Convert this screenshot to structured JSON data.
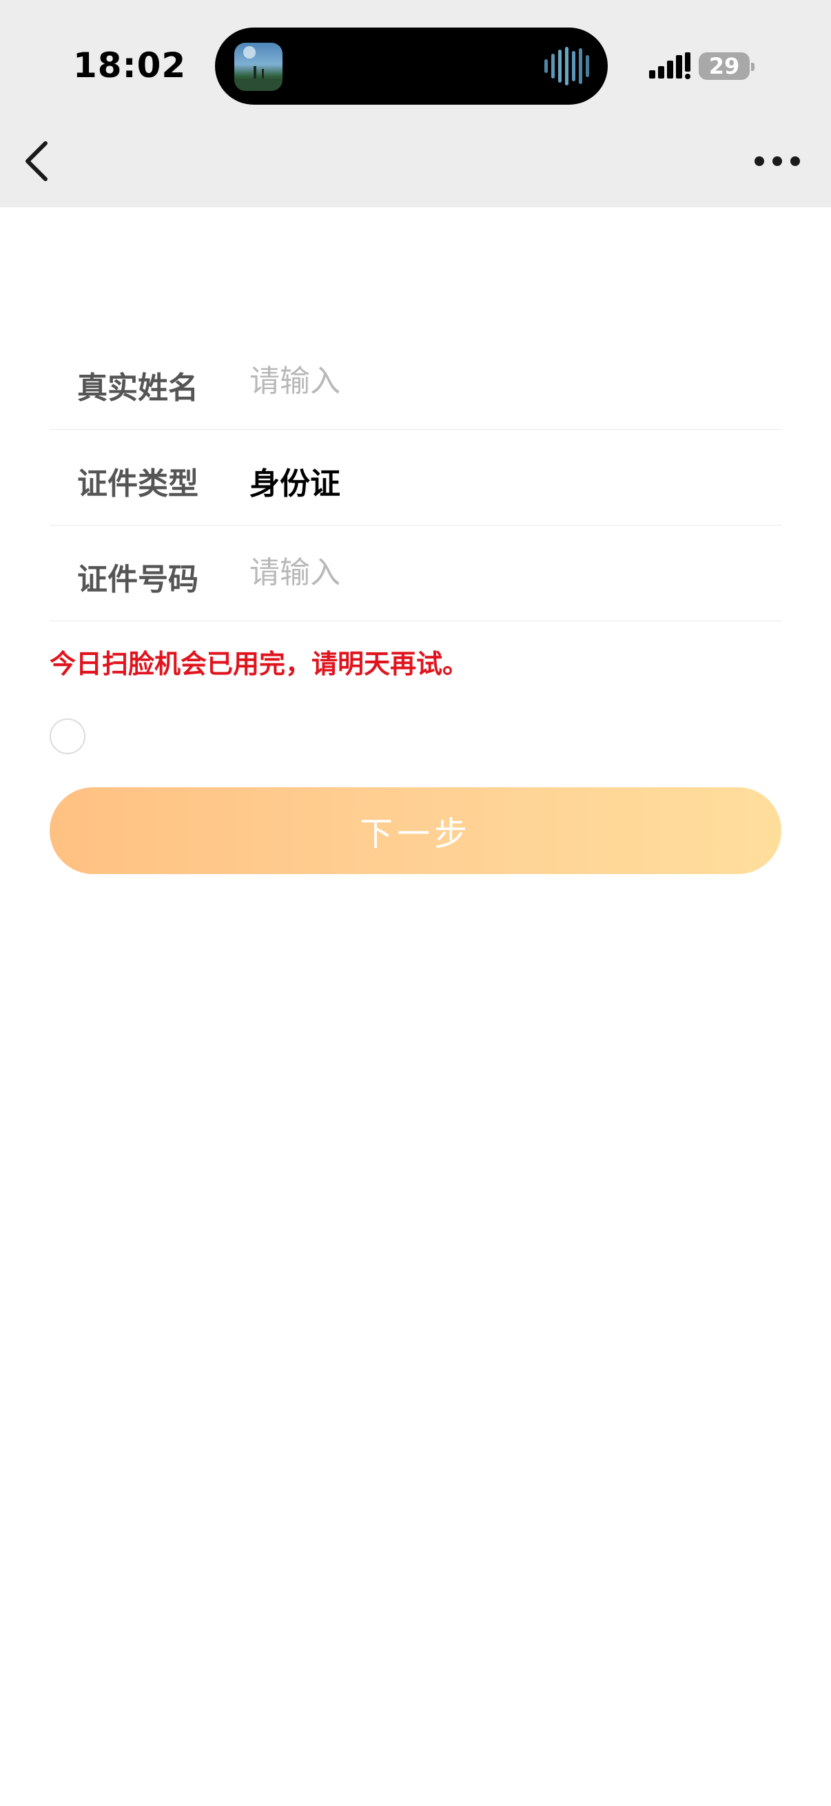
{
  "status_bar": {
    "time": "18:02",
    "battery_level": "29",
    "signal_icon": "cellular-signal-icon",
    "battery_icon": "battery-icon"
  },
  "nav": {
    "back_icon": "chevron-left-icon",
    "more_icon": "more-dots-icon"
  },
  "form": {
    "real_name": {
      "label": "真实姓名",
      "placeholder": "请输入",
      "value": ""
    },
    "id_type": {
      "label": "证件类型",
      "value": "身份证"
    },
    "id_number": {
      "label": "证件号码",
      "placeholder": "请输入",
      "value": ""
    }
  },
  "error_message": "今日扫脸机会已用完，请明天再试。",
  "agreement": {
    "checked": false
  },
  "next_button": {
    "label": "下一步"
  },
  "colors": {
    "error": "#e0141e",
    "button_gradient_start": "#ffc182",
    "button_gradient_end": "#ffde9c",
    "topbar_bg": "#ededed"
  }
}
